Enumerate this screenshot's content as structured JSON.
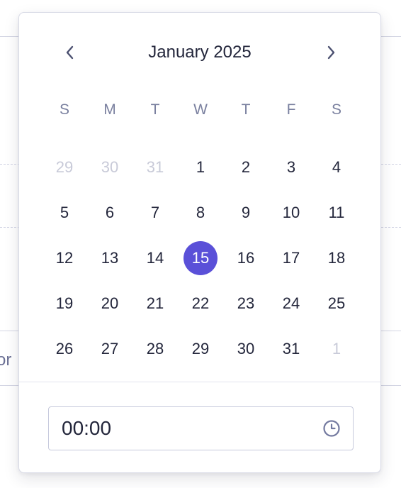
{
  "background": {
    "partial_text": "or"
  },
  "calendar": {
    "month_title": "January 2025",
    "prev_icon": "chevron-left-icon",
    "next_icon": "chevron-right-icon",
    "weekdays": [
      "S",
      "M",
      "T",
      "W",
      "T",
      "F",
      "S"
    ],
    "weeks": [
      [
        {
          "label": "29",
          "muted": true
        },
        {
          "label": "30",
          "muted": true
        },
        {
          "label": "31",
          "muted": true
        },
        {
          "label": "1"
        },
        {
          "label": "2"
        },
        {
          "label": "3"
        },
        {
          "label": "4"
        }
      ],
      [
        {
          "label": "5"
        },
        {
          "label": "6"
        },
        {
          "label": "7"
        },
        {
          "label": "8"
        },
        {
          "label": "9"
        },
        {
          "label": "10"
        },
        {
          "label": "11"
        }
      ],
      [
        {
          "label": "12"
        },
        {
          "label": "13"
        },
        {
          "label": "14"
        },
        {
          "label": "15",
          "selected": true
        },
        {
          "label": "16"
        },
        {
          "label": "17"
        },
        {
          "label": "18"
        }
      ],
      [
        {
          "label": "19"
        },
        {
          "label": "20"
        },
        {
          "label": "21"
        },
        {
          "label": "22"
        },
        {
          "label": "23"
        },
        {
          "label": "24"
        },
        {
          "label": "25"
        }
      ],
      [
        {
          "label": "26"
        },
        {
          "label": "27"
        },
        {
          "label": "28"
        },
        {
          "label": "29"
        },
        {
          "label": "30"
        },
        {
          "label": "31"
        },
        {
          "label": "1",
          "muted": true
        }
      ]
    ],
    "selected_color": "#5a50d8"
  },
  "time": {
    "value": "00:00",
    "icon": "clock-icon"
  }
}
